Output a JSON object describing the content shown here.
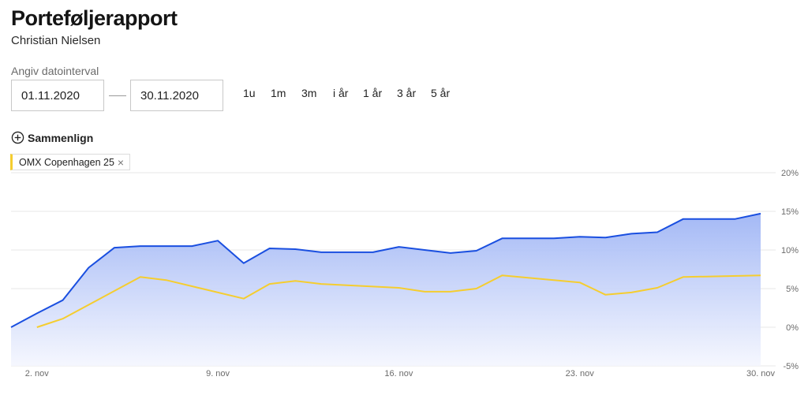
{
  "header": {
    "title": "Porteføljerapport",
    "subtitle": "Christian Nielsen"
  },
  "range": {
    "label": "Angiv datointerval",
    "from": "01.11.2020",
    "to": "30.11.2020"
  },
  "periods": [
    "1u",
    "1m",
    "3m",
    "i år",
    "1 år",
    "3 år",
    "5 år"
  ],
  "compare": {
    "icon": "plus-circle-icon",
    "label": "Sammenlign",
    "chip_label": "OMX Copenhagen 25",
    "chip_close": "×",
    "chip_color": "#f5cd2f"
  },
  "colors": {
    "portfolio": "#1a4fe0",
    "benchmark": "#f5cd2f",
    "fill_top": "#9fb5f5",
    "fill_bottom": "#f4f6fe",
    "grid": "#e7e7e7"
  },
  "chart_data": {
    "type": "line",
    "x_range": [
      "2020-11-01",
      "2020-11-30"
    ],
    "ylim": [
      -5,
      20
    ],
    "y_ticks": [
      20,
      15,
      10,
      5,
      0,
      -5
    ],
    "y_tick_labels": [
      "20%",
      "15%",
      "10%",
      "5%",
      "0%",
      "-5%"
    ],
    "x_ticks": [
      "2020-11-02",
      "2020-11-09",
      "2020-11-16",
      "2020-11-23",
      "2020-11-30"
    ],
    "x_tick_labels": [
      "2. nov",
      "9. nov",
      "16. nov",
      "23. nov",
      "30. nov"
    ],
    "grid": true,
    "series": [
      {
        "name": "",
        "role": "portfolio",
        "area": true,
        "points": [
          [
            "2020-11-01",
            0.0
          ],
          [
            "2020-11-02",
            1.8
          ],
          [
            "2020-11-03",
            3.5
          ],
          [
            "2020-11-04",
            7.7
          ],
          [
            "2020-11-05",
            10.3
          ],
          [
            "2020-11-06",
            10.5
          ],
          [
            "2020-11-07",
            10.5
          ],
          [
            "2020-11-08",
            10.5
          ],
          [
            "2020-11-09",
            11.2
          ],
          [
            "2020-11-10",
            8.3
          ],
          [
            "2020-11-11",
            10.2
          ],
          [
            "2020-11-12",
            10.1
          ],
          [
            "2020-11-13",
            9.7
          ],
          [
            "2020-11-14",
            9.7
          ],
          [
            "2020-11-15",
            9.7
          ],
          [
            "2020-11-16",
            10.4
          ],
          [
            "2020-11-17",
            10.0
          ],
          [
            "2020-11-18",
            9.6
          ],
          [
            "2020-11-19",
            9.9
          ],
          [
            "2020-11-20",
            11.5
          ],
          [
            "2020-11-21",
            11.5
          ],
          [
            "2020-11-22",
            11.5
          ],
          [
            "2020-11-23",
            11.7
          ],
          [
            "2020-11-24",
            11.6
          ],
          [
            "2020-11-25",
            12.1
          ],
          [
            "2020-11-26",
            12.3
          ],
          [
            "2020-11-27",
            14.0
          ],
          [
            "2020-11-28",
            14.0
          ],
          [
            "2020-11-29",
            14.0
          ],
          [
            "2020-11-30",
            14.7
          ]
        ]
      },
      {
        "name": "OMX Copenhagen 25",
        "role": "benchmark",
        "area": false,
        "points": [
          [
            "2020-11-02",
            0.0
          ],
          [
            "2020-11-03",
            1.1
          ],
          [
            "2020-11-06",
            6.5
          ],
          [
            "2020-11-07",
            6.1
          ],
          [
            "2020-11-10",
            3.7
          ],
          [
            "2020-11-11",
            5.6
          ],
          [
            "2020-11-12",
            6.0
          ],
          [
            "2020-11-13",
            5.6
          ],
          [
            "2020-11-16",
            5.1
          ],
          [
            "2020-11-17",
            4.6
          ],
          [
            "2020-11-18",
            4.6
          ],
          [
            "2020-11-19",
            5.0
          ],
          [
            "2020-11-20",
            6.7
          ],
          [
            "2020-11-23",
            5.8
          ],
          [
            "2020-11-24",
            4.2
          ],
          [
            "2020-11-25",
            4.5
          ],
          [
            "2020-11-26",
            5.1
          ],
          [
            "2020-11-27",
            6.5
          ],
          [
            "2020-11-30",
            6.7
          ]
        ]
      }
    ]
  }
}
